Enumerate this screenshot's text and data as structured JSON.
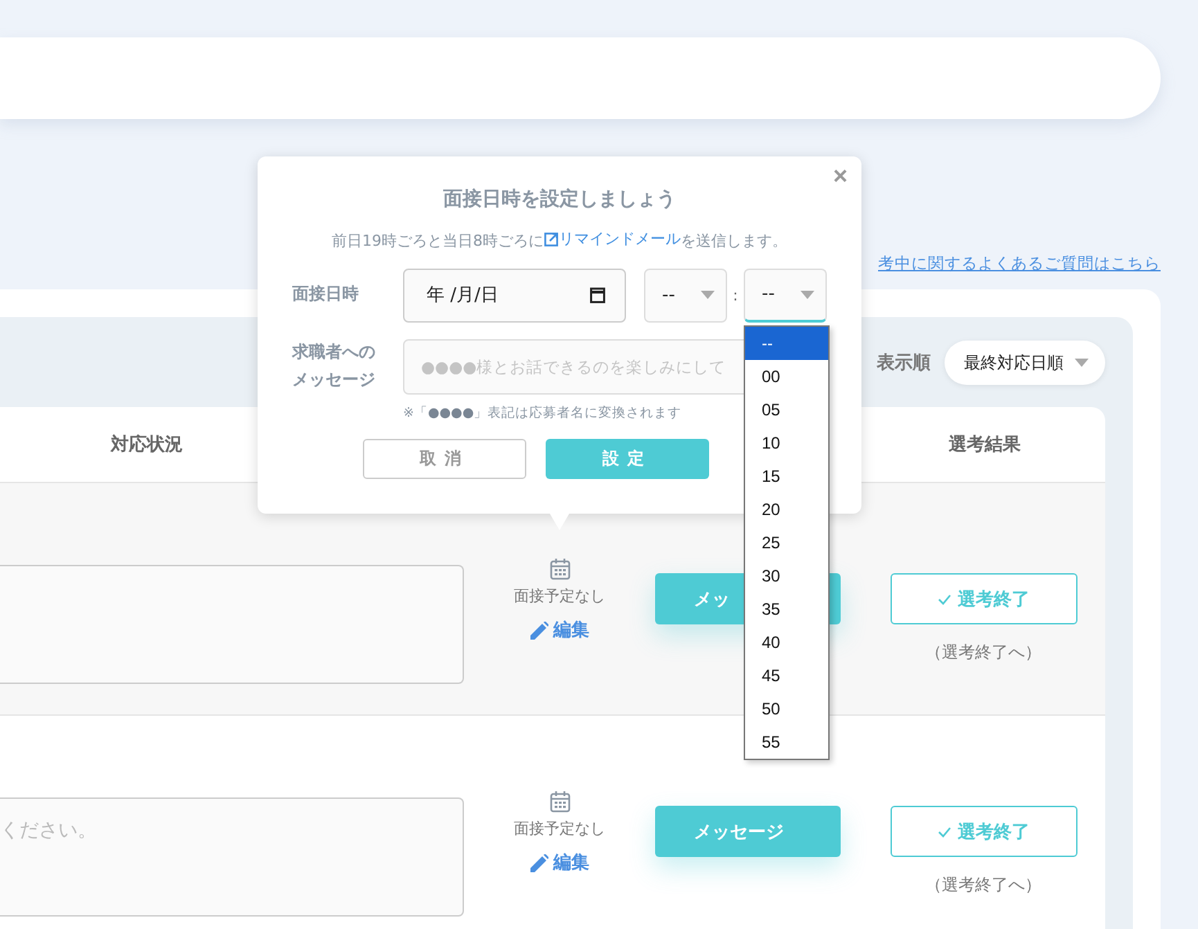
{
  "faq_link": "考中に関するよくあるご質問はこちら",
  "sort": {
    "label": "表示順",
    "value": "最終対応日順"
  },
  "table": {
    "columns": [
      "対応状況",
      "選考結果"
    ],
    "rows": [
      {
        "memo_placeholder": null,
        "interview_status": "面接予定なし",
        "edit": "編集",
        "message_button": "メッ",
        "result_button": "選考終了",
        "result_note": "（選考終了へ）"
      },
      {
        "memo_placeholder": "ください。",
        "interview_status": "面接予定なし",
        "edit": "編集",
        "message_button": "メッセージ",
        "result_button": "選考終了",
        "result_note": "（選考終了へ）"
      }
    ]
  },
  "modal": {
    "close": "×",
    "title": "面接日時を設定しましょう",
    "subtitle_before": "前日19時ごろと当日8時ごろに",
    "subtitle_link": "リマインドメール",
    "subtitle_after": "を送信します。",
    "date_label": "面接日時",
    "date_value": "年 /月/日",
    "hour": "--",
    "separator": ":",
    "minute": "--",
    "message_label": [
      "求職者への",
      "メッセージ"
    ],
    "message_placeholder": "●●●●様とお話できるのを楽しみにして",
    "note": "※「**●●●●**」表記は応募者名に変換されます",
    "cancel": "取消",
    "submit": "設定"
  },
  "minute_options": [
    {
      "label": "--",
      "selected": true
    },
    {
      "label": "00",
      "selected": false
    },
    {
      "label": "05",
      "selected": false
    },
    {
      "label": "10",
      "selected": false
    },
    {
      "label": "15",
      "selected": false
    },
    {
      "label": "20",
      "selected": false
    },
    {
      "label": "25",
      "selected": false
    },
    {
      "label": "30",
      "selected": false
    },
    {
      "label": "35",
      "selected": false
    },
    {
      "label": "40",
      "selected": false
    },
    {
      "label": "45",
      "selected": false
    },
    {
      "label": "50",
      "selected": false
    },
    {
      "label": "55",
      "selected": false
    }
  ]
}
